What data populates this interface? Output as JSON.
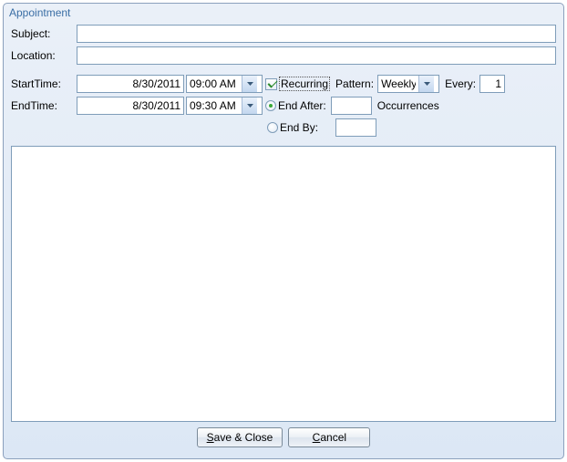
{
  "window": {
    "title": "Appointment"
  },
  "labels": {
    "subject": "Subject:",
    "location": "Location:",
    "start": "StartTime:",
    "end": "EndTime:",
    "recurring": "Recurring",
    "pattern": "Pattern:",
    "every": "Every:",
    "endAfter": "End After:",
    "occurrences": "Occurrences",
    "endBy": "End By:"
  },
  "fields": {
    "subject": "",
    "location": "",
    "startDate": "8/30/2011",
    "startTime": "09:00 AM",
    "endDate": "8/30/2011",
    "endTime": "09:30 AM",
    "recurring": true,
    "pattern": "Weekly",
    "every": "1",
    "endMode": "after",
    "endAfter": "",
    "endBy": ""
  },
  "buttons": {
    "saveCloseText": "ave & Close",
    "cancelText": "ancel"
  }
}
